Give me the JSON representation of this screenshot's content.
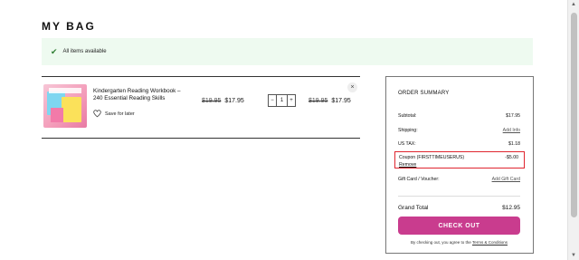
{
  "page": {
    "title": "MY BAG"
  },
  "availability": {
    "icon": "check-icon",
    "text": "All items available"
  },
  "item": {
    "title": "Kindergarten Reading Workbook – 240 Essential Reading Skills",
    "save_label": "Save for later",
    "unit_price_old": "$19.95",
    "unit_price_new": "$17.95",
    "quantity": "1",
    "decrement_label": "−",
    "increment_label": "+",
    "total_price_old": "$19.95",
    "total_price_new": "$17.95",
    "remove_label": "×"
  },
  "summary": {
    "heading": "ORDER SUMMARY",
    "subtotal_label": "Subtotal:",
    "subtotal_value": "$17.95",
    "shipping_label": "Shipping:",
    "shipping_link": "Add Info",
    "tax_label": "US TAX:",
    "tax_value": "$1.18",
    "coupon_label": "Coupon (FIRSTTIMEUSERUS)",
    "coupon_value": "-$5.00",
    "coupon_remove": "Remove",
    "gift_label": "Gift Card / Voucher:",
    "gift_link": "Add Gift Card",
    "grand_label": "Grand Total",
    "grand_value": "$12.95",
    "checkout_label": "CHECK OUT",
    "terms_prefix": "By checking out, you agree to the",
    "terms_link": "Terms & Conditions"
  },
  "colors": {
    "checkout": "#c93c8e",
    "coupon_border": "#e0252f",
    "availability_bg": "#eefaf0"
  }
}
